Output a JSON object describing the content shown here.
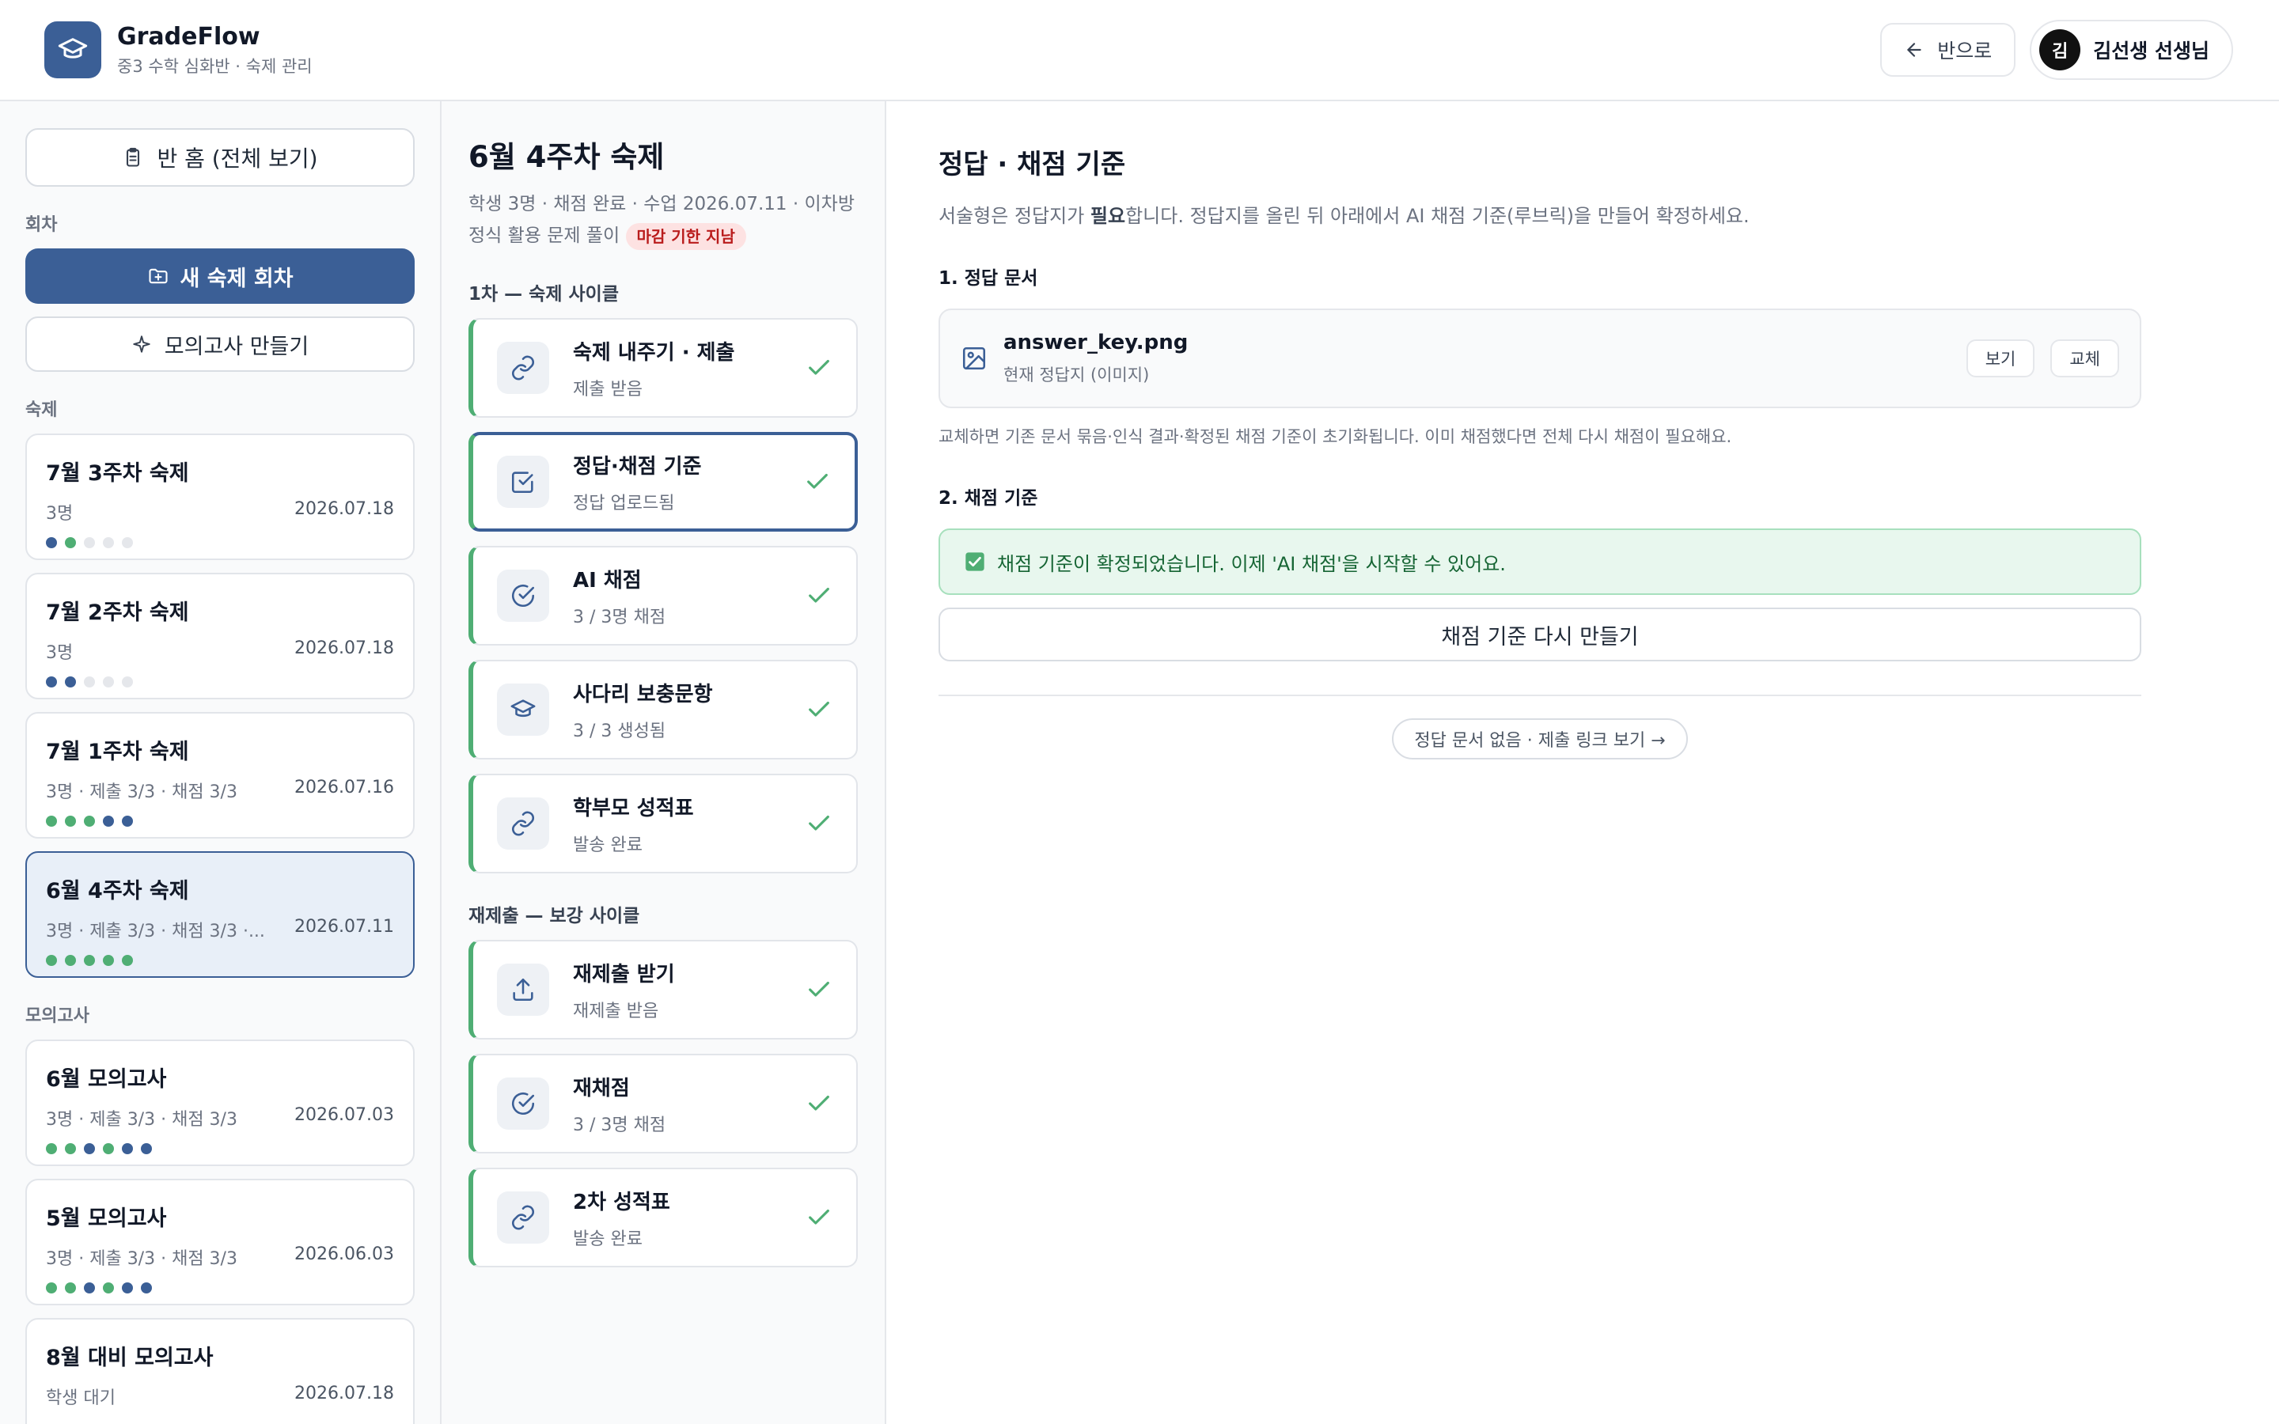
{
  "colors": {
    "accent": "#3b5f96",
    "success": "#4fae74",
    "danger": "#b91c1c"
  },
  "header": {
    "app_name": "GradeFlow",
    "class_name": "중3 수학 심화반 · 숙제 관리",
    "back_label": "반으로",
    "user_initial": "김",
    "user_name": "김선생 선생님"
  },
  "sidebar": {
    "home_label": "반 홈 (전체 보기)",
    "section_rounds": "회차",
    "new_round_label": "새 숙제 회차",
    "mock_exam_label": "모의고사 만들기",
    "section_homework": "숙제",
    "homework": [
      {
        "title": "7월 3주차 숙제",
        "meta": "3명",
        "date": "2026.07.18",
        "dots": [
          "blue",
          "green",
          "gray",
          "gray",
          "gray"
        ]
      },
      {
        "title": "7월 2주차 숙제",
        "meta": "3명",
        "date": "2026.07.18",
        "dots": [
          "blue",
          "blue",
          "gray",
          "gray",
          "gray"
        ]
      },
      {
        "title": "7월 1주차 숙제",
        "meta": "3명 · 제출 3/3 · 채점 3/3",
        "date": "2026.07.16",
        "dots": [
          "green",
          "green",
          "green",
          "blue",
          "blue"
        ]
      },
      {
        "title": "6월 4주차 숙제",
        "meta": "3명 · 제출 3/3 · 채점 3/3 ·...",
        "date": "2026.07.11",
        "dots": [
          "green",
          "green",
          "green",
          "green",
          "green"
        ],
        "selected": true
      }
    ],
    "section_mock": "모의고사",
    "mock_exams": [
      {
        "title": "6월 모의고사",
        "meta": "3명 · 제출 3/3 · 채점 3/3",
        "date": "2026.07.03",
        "dots": [
          "green",
          "green",
          "blue",
          "green",
          "blue",
          "blue"
        ]
      },
      {
        "title": "5월 모의고사",
        "meta": "3명 · 제출 3/3 · 채점 3/3",
        "date": "2026.06.03",
        "dots": [
          "green",
          "green",
          "blue",
          "green",
          "blue",
          "blue"
        ]
      },
      {
        "title": "8월 대비 모의고사",
        "meta": "학생 대기",
        "date": "2026.07.18",
        "dots": []
      }
    ]
  },
  "middle": {
    "title": "6월 4주차 숙제",
    "desc": "학생 3명 · 채점 완료 · 수업 2026.07.11 · 이차방정식 활용 문제 풀이",
    "overdue_badge": "마감 기한 지남",
    "cycle1_label": "1차 — 숙제 사이클",
    "cycle1_steps": [
      {
        "title": "숙제 내주기 · 제출",
        "sub": "제출 받음",
        "icon": "link-icon"
      },
      {
        "title": "정답·채점 기준",
        "sub": "정답 업로드됨",
        "icon": "checkbox-icon",
        "active": true
      },
      {
        "title": "AI 채점",
        "sub": "3 / 3명 채점",
        "icon": "check-circle-icon"
      },
      {
        "title": "사다리 보충문항",
        "sub": "3 / 3 생성됨",
        "icon": "graduation-cap-icon"
      },
      {
        "title": "학부모 성적표",
        "sub": "발송 완료",
        "icon": "link-icon"
      }
    ],
    "cycle2_label": "재제출 — 보강 사이클",
    "cycle2_steps": [
      {
        "title": "재제출 받기",
        "sub": "재제출 받음",
        "icon": "upload-icon"
      },
      {
        "title": "재채점",
        "sub": "3 / 3명 채점",
        "icon": "check-circle-icon"
      },
      {
        "title": "2차 성적표",
        "sub": "발송 완료",
        "icon": "link-icon"
      }
    ]
  },
  "main": {
    "title": "정답 · 채점 기준",
    "desc_before": "서술형은 정답지가 ",
    "desc_bold": "필요",
    "desc_after": "합니다. 정답지를 올린 뒤 아래에서 AI 채점 기준(루브릭)을 만들어 확정하세요.",
    "section1": "1. 정답 문서",
    "file_name": "answer_key.png",
    "file_sub": "현재 정답지 (이미지)",
    "view_label": "보기",
    "replace_label": "교체",
    "replace_note": "교체하면 기존 문서 묶음·인식 결과·확정된 채점 기준이 초기화됩니다. 이미 채점했다면 전체 다시 채점이 필요해요.",
    "section2": "2. 채점 기준",
    "success_msg": "채점 기준이 확정되었습니다. 이제 'AI 채점'을 시작할 수 있어요.",
    "regen_label": "채점 기준 다시 만들기",
    "no_doc_link": "정답 문서 없음 · 제출 링크 보기 →"
  }
}
